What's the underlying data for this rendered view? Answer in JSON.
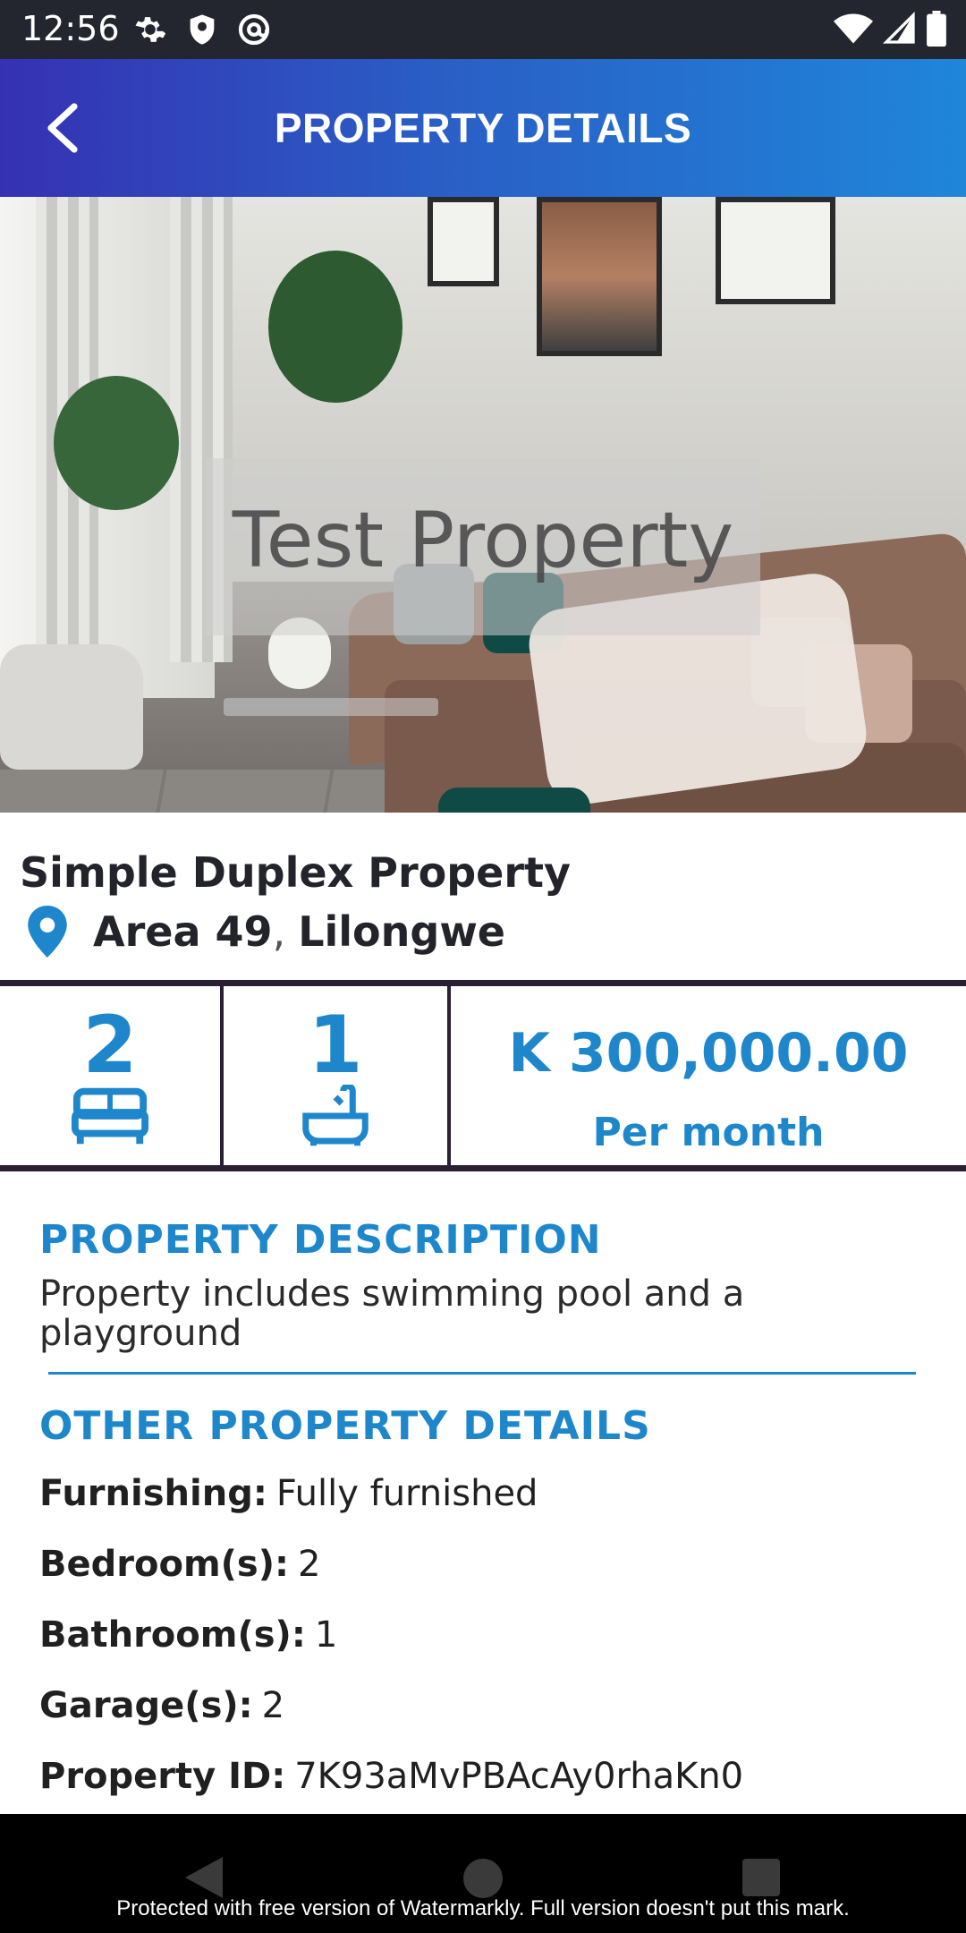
{
  "status_bar": {
    "time": "12:56",
    "icons_left": [
      "settings-icon",
      "shield-icon",
      "at-sign-icon"
    ],
    "icons_right": [
      "wifi-icon",
      "signal-icon",
      "battery-icon"
    ]
  },
  "app_bar": {
    "title": "PROPERTY DETAILS",
    "back_icon": "chevron-left-icon"
  },
  "hero": {
    "watermark_text": "Test Property"
  },
  "property": {
    "name": "Simple Duplex Property",
    "area": "Area 49",
    "separator": ",",
    "city": "Lilongwe",
    "bedrooms": "2",
    "bathrooms": "1",
    "price": "K 300,000.00",
    "price_period": "Per month"
  },
  "description": {
    "heading": "PROPERTY DESCRIPTION",
    "text": "Property includes swimming pool and a playground"
  },
  "other_details": {
    "heading": "OTHER PROPERTY DETAILS",
    "rows": [
      {
        "label": "Furnishing:",
        "value": "Fully furnished"
      },
      {
        "label": "Bedroom(s):",
        "value": "2"
      },
      {
        "label": "Bathroom(s):",
        "value": "1"
      },
      {
        "label": "Garage(s):",
        "value": "2"
      },
      {
        "label": "Property ID:",
        "value": "7K93aMvPBAcAy0rhaKn0"
      }
    ]
  },
  "nav_bar": {
    "watermark": "Protected with free version of Watermarkly. Full version doesn't put this mark."
  },
  "colors": {
    "accent": "#1e87cc",
    "app_bar_start": "#3531b3",
    "app_bar_end": "#1f86d8",
    "divider_dark": "#2a1f33"
  }
}
